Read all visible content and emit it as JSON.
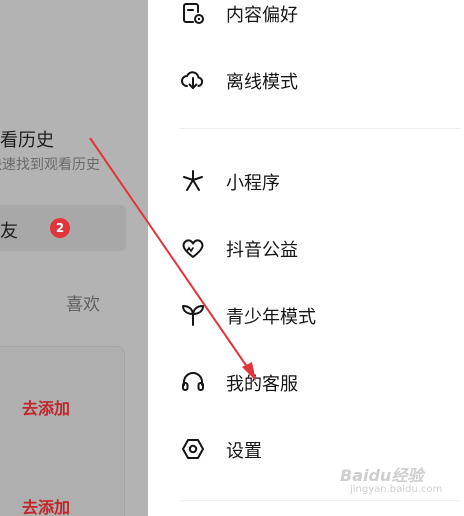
{
  "background": {
    "history_title": "观看历史",
    "history_subtitle": "快速找到观看历史",
    "friends_label": "朋友",
    "friends_badge": "2",
    "like_tab": "喜欢",
    "add_button_1": "去添加",
    "add_button_2": "去添加"
  },
  "menu": {
    "items": [
      {
        "label": "内容偏好",
        "icon": "content-preference-icon"
      },
      {
        "label": "离线模式",
        "icon": "cloud-download-icon"
      },
      {
        "label": "小程序",
        "icon": "mini-program-icon"
      },
      {
        "label": "抖音公益",
        "icon": "charity-heart-icon"
      },
      {
        "label": "青少年模式",
        "icon": "sprout-icon"
      },
      {
        "label": "我的客服",
        "icon": "headset-icon"
      },
      {
        "label": "设置",
        "icon": "settings-hexagon-icon"
      }
    ]
  },
  "watermark": {
    "brand": "Baidu经验",
    "url": "jingyan.baidu.com"
  },
  "colors": {
    "arrow": "#e0353b",
    "badge": "#e0353b",
    "add_button_text": "#c0262a",
    "overlay_dim": "#b3b3b3"
  }
}
